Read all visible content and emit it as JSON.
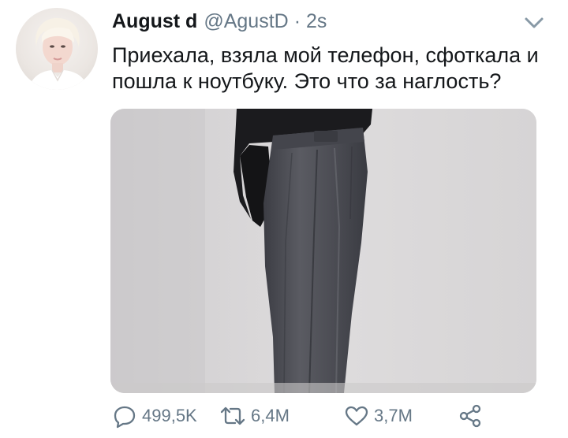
{
  "tweet": {
    "display_name": "August d",
    "handle": "@AgustD",
    "separator": "·",
    "time": "2s",
    "text_lines": [
      "Приехала, взяла мой телефон, сфоткала и",
      "пошла к ноутбуку. Это что за наглость?"
    ],
    "reply_count": "499,5K",
    "retweet_count": "6,4M",
    "like_count": "3,7M"
  },
  "icons": {
    "menu": "chevron-down-icon",
    "reply": "comment-icon",
    "retweet": "retweet-icon",
    "like": "heart-icon",
    "share": "share-icon"
  },
  "colors": {
    "text_primary": "#14171a",
    "text_secondary": "#657786",
    "background": "#ffffff"
  }
}
